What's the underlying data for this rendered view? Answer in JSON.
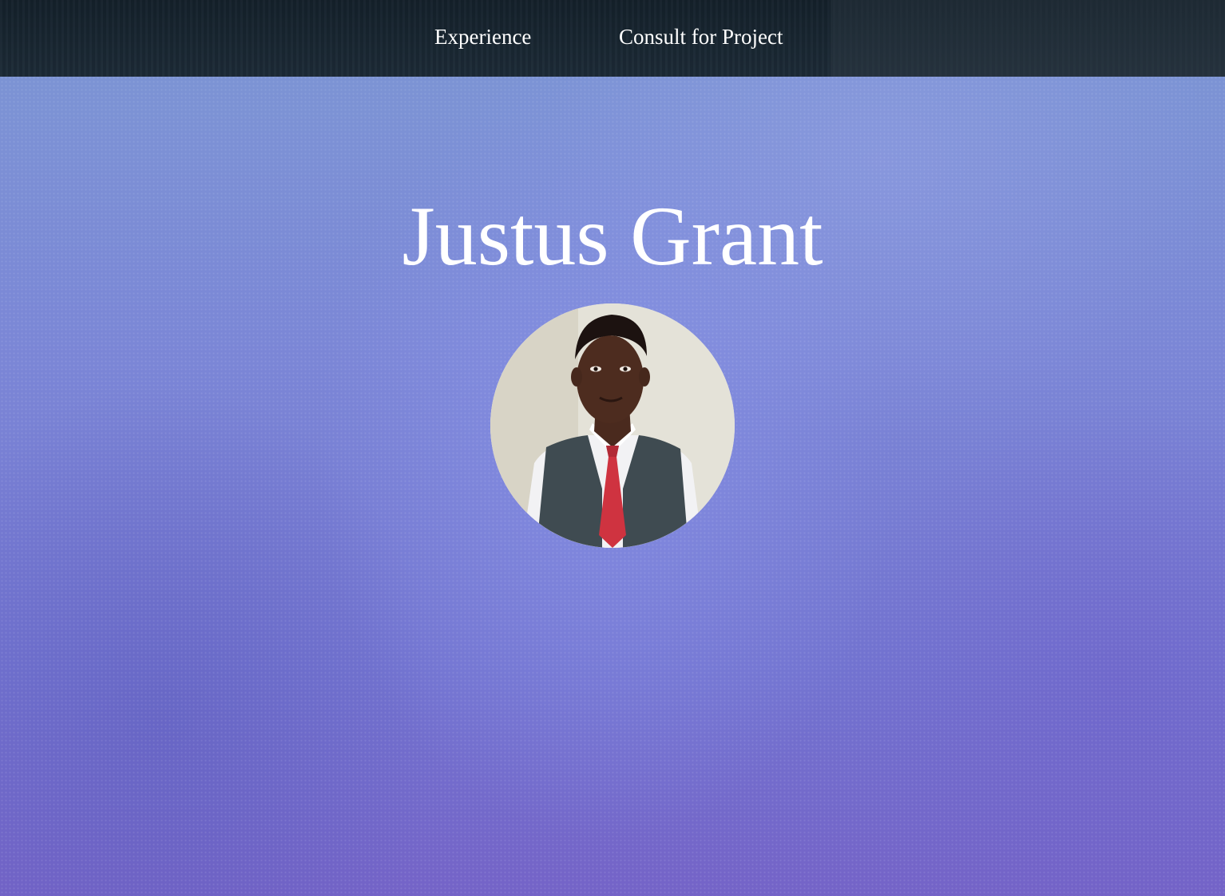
{
  "nav": {
    "items": [
      {
        "label": "Experience"
      },
      {
        "label": "Consult for Project"
      }
    ]
  },
  "hero": {
    "name": "Justus Grant",
    "avatar_alt": "Portrait photo of Justus Grant"
  },
  "colors": {
    "navbar_bg": "#1a2631",
    "hero_top": "#7c97d4",
    "hero_bottom": "#7463c7",
    "text": "#ffffff",
    "tie_red": "#d1323f",
    "vest": "#3e4a50"
  }
}
